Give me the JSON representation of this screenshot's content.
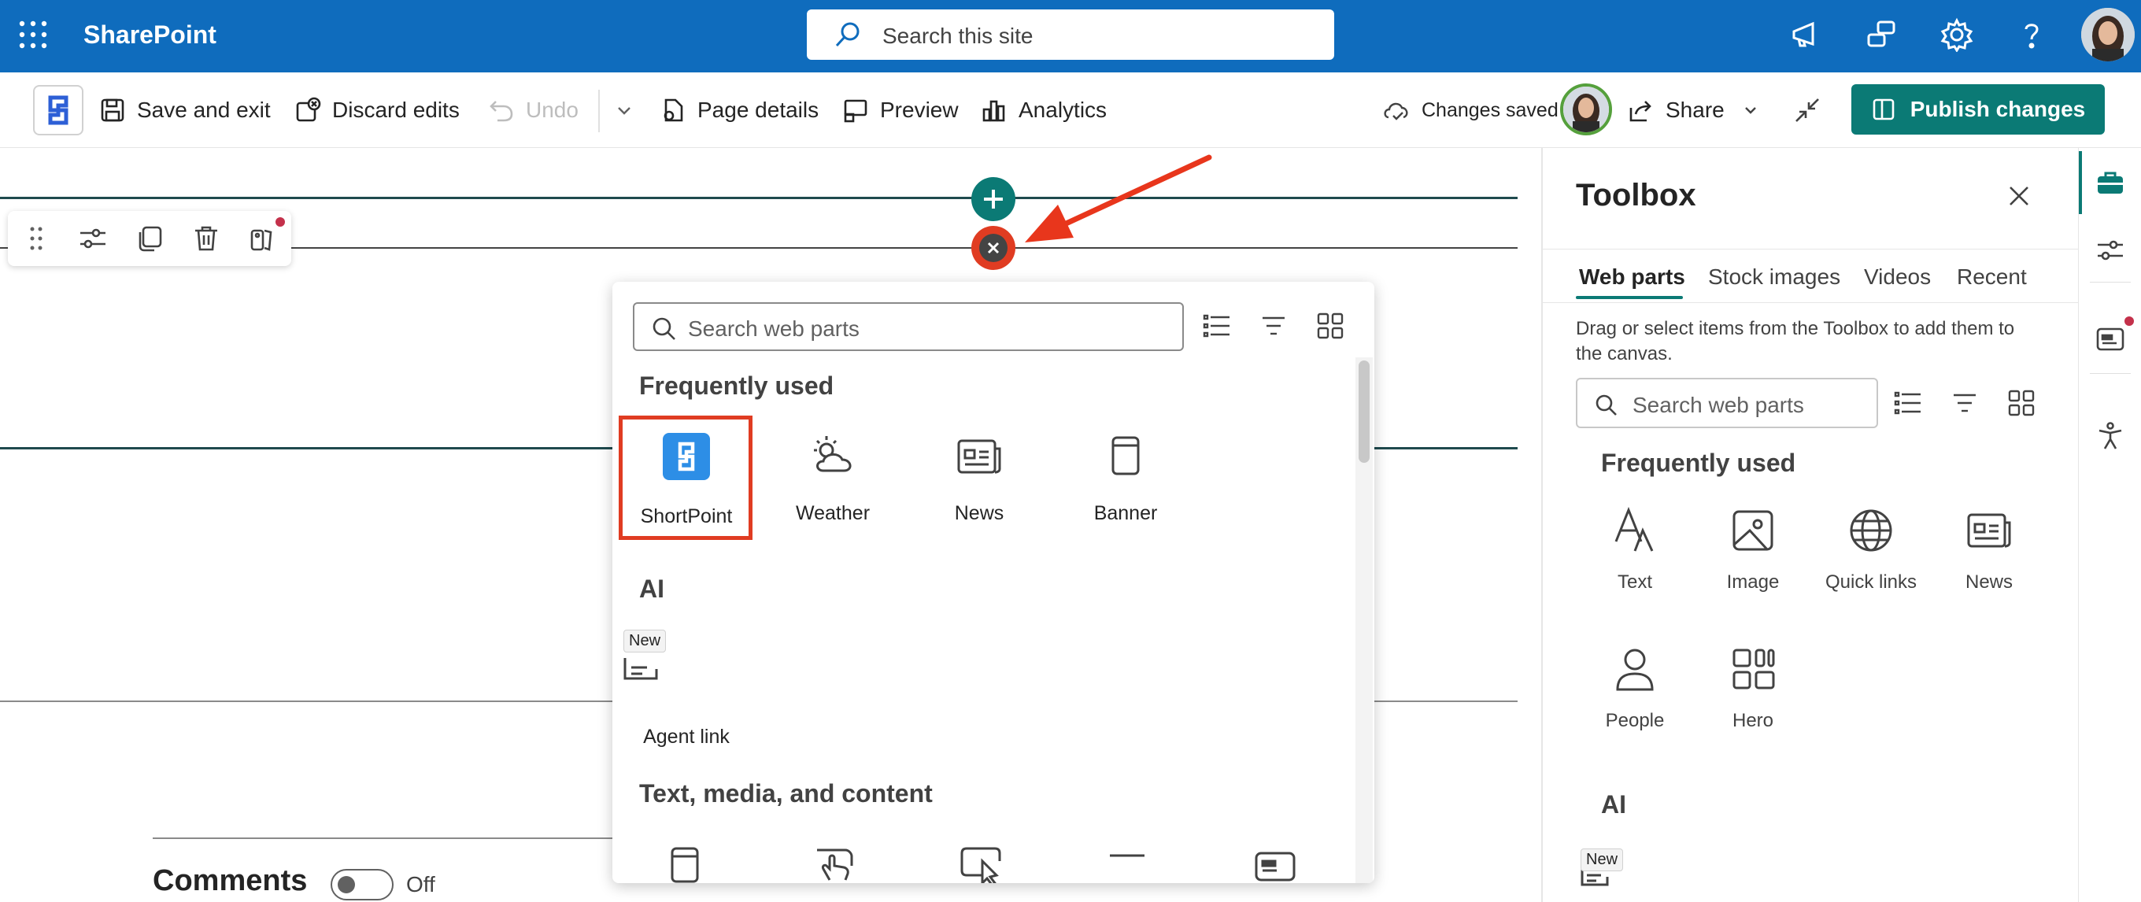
{
  "suite_bar": {
    "brand": "SharePoint",
    "search_placeholder": "Search this site"
  },
  "command_bar": {
    "save_and_exit": "Save and exit",
    "discard_edits": "Discard edits",
    "undo": "Undo",
    "page_details": "Page details",
    "preview": "Preview",
    "analytics": "Analytics",
    "changes_saved": "Changes saved",
    "share": "Share",
    "publish": "Publish changes"
  },
  "web_part_picker": {
    "search_placeholder": "Search web parts",
    "sections": {
      "frequently_used": "Frequently used",
      "ai": "AI",
      "text_media": "Text, media, and content"
    },
    "frequently_used": [
      "ShortPoint",
      "Weather",
      "News",
      "Banner"
    ],
    "ai_items": [
      "Agent link"
    ],
    "new_badge": "New"
  },
  "comments": {
    "label": "Comments",
    "toggle_state": "Off"
  },
  "toolbox": {
    "title": "Toolbox",
    "tabs": [
      "Web parts",
      "Stock images",
      "Videos",
      "Recent"
    ],
    "description": "Drag or select items from the Toolbox to add them to the canvas.",
    "search_placeholder": "Search web parts",
    "frequently_used_heading": "Frequently used",
    "frequently_used": [
      "Text",
      "Image",
      "Quick links",
      "News",
      "People",
      "Hero"
    ],
    "ai_heading": "AI",
    "new_badge": "New"
  },
  "colors": {
    "suite_blue": "#0f6cbd",
    "accent_teal": "#0b7a75",
    "highlight_red": "#e03c22",
    "shortpoint_blue": "#2d8ee6"
  }
}
